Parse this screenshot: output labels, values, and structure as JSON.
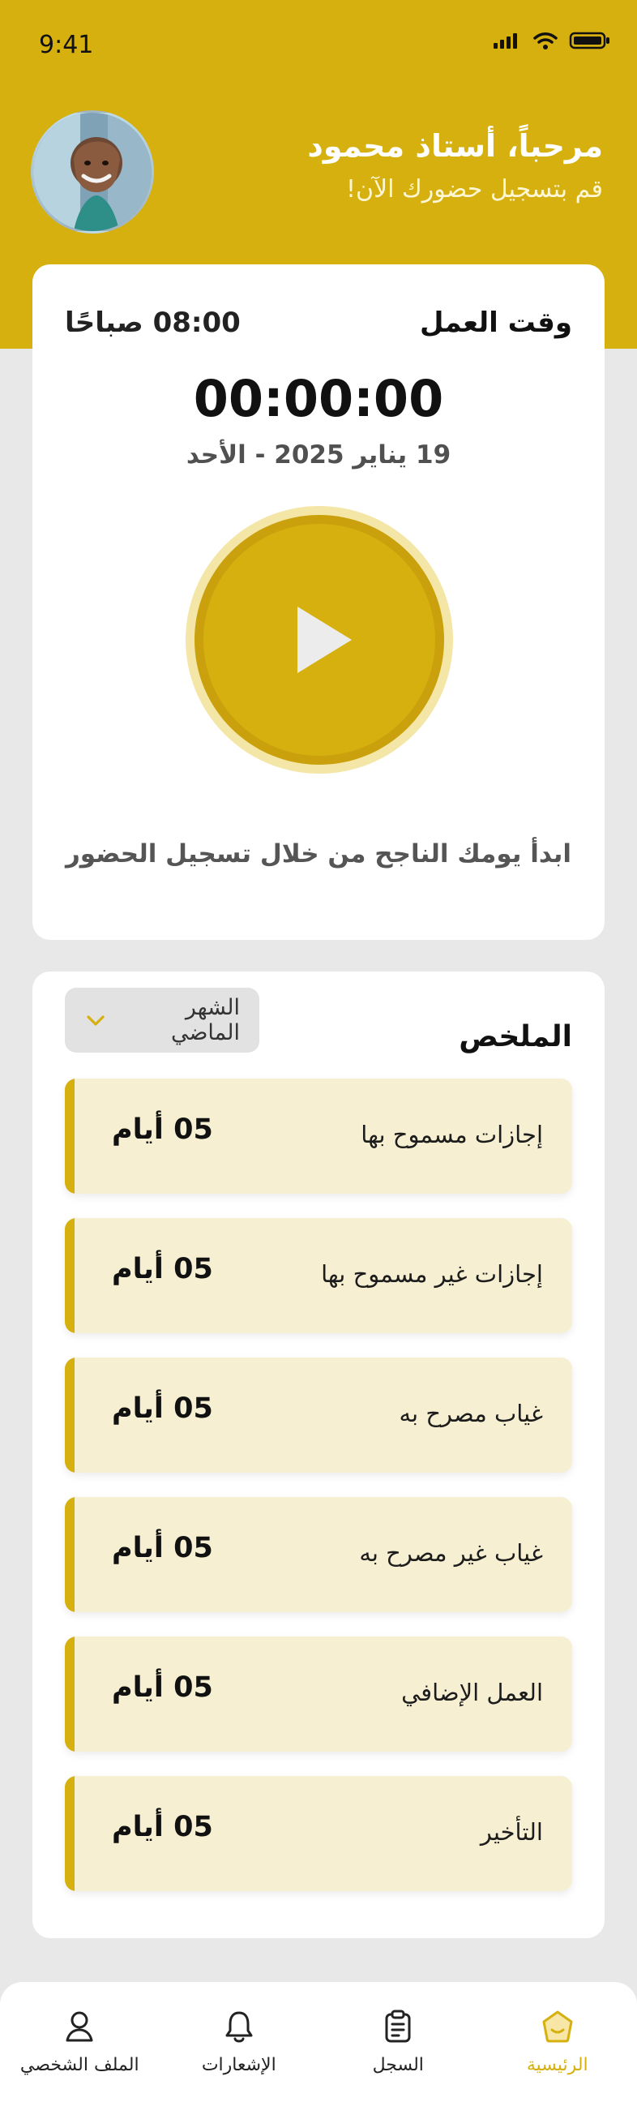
{
  "status_bar": {
    "time": "9:41",
    "icons": [
      "signal-icon",
      "wifi-icon",
      "battery-icon"
    ]
  },
  "header": {
    "title": "مرحباً، أستاذ محمود",
    "subtitle": "قم بتسجيل حضورك الآن!",
    "avatar_icon": "user-photo"
  },
  "work": {
    "label": "وقت العمل",
    "time": "08:00 صباحًا",
    "timer": "00:00:00",
    "date": "19 يناير 2025 - الأحد",
    "start_text": "ابدأ يومك الناجح من خلال تسجيل الحضور",
    "play_icon": "play-icon"
  },
  "summary": {
    "title": "الملخص",
    "filter": "الشهر الماضي",
    "filter_icon": "chevron-down-icon",
    "items": [
      {
        "label": "إجازات مسموح بها",
        "value": "05 أيام"
      },
      {
        "label": "إجازات غير مسموح بها",
        "value": "05 أيام"
      },
      {
        "label": "غياب مصرح به",
        "value": "05 أيام"
      },
      {
        "label": "غياب غير مصرح به",
        "value": "05 أيام"
      },
      {
        "label": "العمل الإضافي",
        "value": "05 أيام"
      },
      {
        "label": "التأخير",
        "value": "05 أيام"
      }
    ]
  },
  "nav": {
    "items": [
      {
        "label": "الرئيسية",
        "icon": "home-icon",
        "active": true
      },
      {
        "label": "السجل",
        "icon": "clipboard-icon",
        "active": false
      },
      {
        "label": "الإشعارات",
        "icon": "bell-icon",
        "active": false
      },
      {
        "label": "الملف الشخصي",
        "icon": "user-icon",
        "active": false
      }
    ]
  },
  "colors": {
    "accent": "#d6b00f",
    "background": "#e8e8e8",
    "card": "#ffffff",
    "item_background": "#f6efd1"
  }
}
